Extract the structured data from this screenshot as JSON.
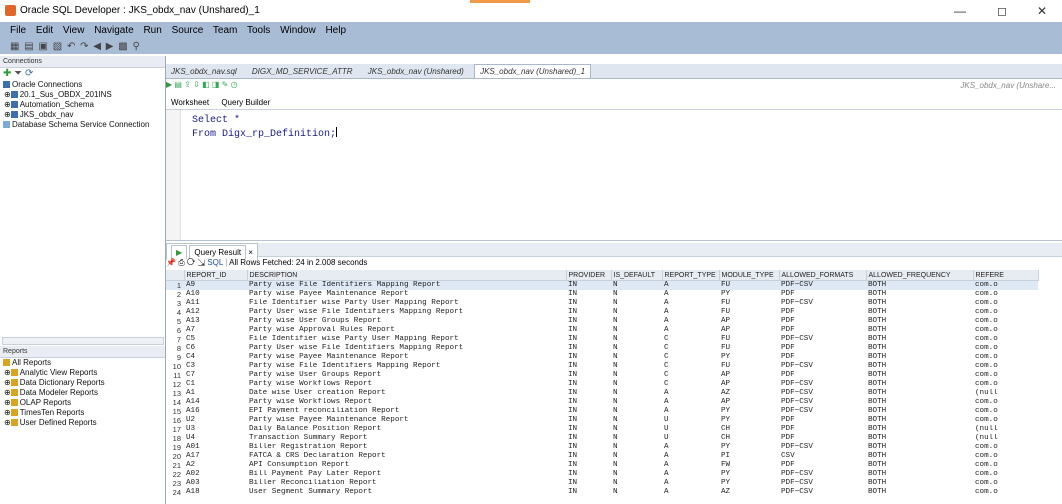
{
  "window": {
    "title": "Oracle SQL Developer : JKS_obdx_nav (Unshared)_1",
    "minimize": "—",
    "maximize": "◻",
    "close": "✕"
  },
  "menu": [
    "File",
    "Edit",
    "View",
    "Navigate",
    "Run",
    "Source",
    "Team",
    "Tools",
    "Window",
    "Help"
  ],
  "connections": {
    "header": "Connections",
    "items": [
      "Oracle Connections",
      "20.1_Sus_OBDX_201INS",
      "Automation_Schema",
      "JKS_obdx_nav",
      "Database Schema Service Connection"
    ]
  },
  "reports": {
    "header": "Reports",
    "items": [
      "All Reports",
      "Analytic View Reports",
      "Data Dictionary Reports",
      "Data Modeler Reports",
      "OLAP Reports",
      "TimesTen Reports",
      "User Defined Reports"
    ]
  },
  "doc_tabs": [
    "JKS_obdx_nav.sql",
    "DIGX_MD_SERVICE_ATTR",
    "JKS_obdx_nav (Unshared)",
    "JKS_obdx_nav (Unshared)_1"
  ],
  "connection_selector": "JKS_obdx_nav (Unshare...",
  "worksheet_tabs": [
    "Worksheet",
    "Query Builder"
  ],
  "editor": {
    "line1": "Select *",
    "line2": "From Digx_rp_Definition;"
  },
  "result_tab": "Query Result",
  "result_status": "All Rows Fetched: 24 in 2.008 seconds",
  "sql_label": "SQL",
  "columns": [
    "REPORT_ID",
    "DESCRIPTION",
    "PROVIDER",
    "IS_DEFAULT",
    "REPORT_TYPE",
    "MODULE_TYPE",
    "ALLOWED_FORMATS",
    "ALLOWED_FREQUENCY",
    "REFERE"
  ],
  "rows": [
    [
      "1",
      "A9",
      "Party wise File Identifiers Mapping Report",
      "IN",
      "N",
      "A",
      "FU",
      "PDF~CSV",
      "BOTH",
      "com.o"
    ],
    [
      "2",
      "A10",
      "Party wise Payee Maintenance Report",
      "IN",
      "N",
      "A",
      "PY",
      "PDF",
      "BOTH",
      "com.o"
    ],
    [
      "3",
      "A11",
      "File Identifier wise Party User Mapping Report",
      "IN",
      "N",
      "A",
      "FU",
      "PDF~CSV",
      "BOTH",
      "com.o"
    ],
    [
      "4",
      "A12",
      "Party User wise File Identifiers Mapping Report",
      "IN",
      "N",
      "A",
      "FU",
      "PDF",
      "BOTH",
      "com.o"
    ],
    [
      "5",
      "A13",
      "Party wise User Groups Report",
      "IN",
      "N",
      "A",
      "AP",
      "PDF",
      "BOTH",
      "com.o"
    ],
    [
      "6",
      "A7",
      "Party wise Approval Rules Report",
      "IN",
      "N",
      "A",
      "AP",
      "PDF",
      "BOTH",
      "com.o"
    ],
    [
      "7",
      "C5",
      "File Identifier wise Party User Mapping Report",
      "IN",
      "N",
      "C",
      "FU",
      "PDF~CSV",
      "BOTH",
      "com.o"
    ],
    [
      "8",
      "C6",
      "Party User wise File Identifiers Mapping Report",
      "IN",
      "N",
      "C",
      "FU",
      "PDF",
      "BOTH",
      "com.o"
    ],
    [
      "9",
      "C4",
      "Party wise Payee Maintenance Report",
      "IN",
      "N",
      "C",
      "PY",
      "PDF",
      "BOTH",
      "com.o"
    ],
    [
      "10",
      "C3",
      "Party wise File Identifiers Mapping Report",
      "IN",
      "N",
      "C",
      "FU",
      "PDF~CSV",
      "BOTH",
      "com.o"
    ],
    [
      "11",
      "C7",
      "Party wise User Groups Report",
      "IN",
      "N",
      "C",
      "AP",
      "PDF",
      "BOTH",
      "com.o"
    ],
    [
      "12",
      "C1",
      "Party wise Workflows Report",
      "IN",
      "N",
      "C",
      "AP",
      "PDF~CSV",
      "BOTH",
      "com.o"
    ],
    [
      "13",
      "A1",
      "Date wise User creation Report",
      "IN",
      "N",
      "A",
      "AZ",
      "PDF~CSV",
      "BOTH",
      "(null"
    ],
    [
      "14",
      "A14",
      "Party wise Workflows Report",
      "IN",
      "N",
      "A",
      "AP",
      "PDF~CSV",
      "BOTH",
      "com.o"
    ],
    [
      "15",
      "A16",
      "EPI Payment reconciliation Report",
      "IN",
      "N",
      "A",
      "PY",
      "PDF~CSV",
      "BOTH",
      "com.o"
    ],
    [
      "16",
      "U2",
      "Party wise Payee Maintenance Report",
      "IN",
      "N",
      "U",
      "PY",
      "PDF",
      "BOTH",
      "com.o"
    ],
    [
      "17",
      "U3",
      "Daily Balance Position Report",
      "IN",
      "N",
      "U",
      "CH",
      "PDF",
      "BOTH",
      "(null"
    ],
    [
      "18",
      "U4",
      "Transaction Summary Report",
      "IN",
      "N",
      "U",
      "CH",
      "PDF",
      "BOTH",
      "(null"
    ],
    [
      "19",
      "A01",
      "Biller Registration Report",
      "IN",
      "N",
      "A",
      "PY",
      "PDF~CSV",
      "BOTH",
      "com.o"
    ],
    [
      "20",
      "A17",
      "FATCA & CRS Declaration Report",
      "IN",
      "N",
      "A",
      "PI",
      "CSV",
      "BOTH",
      "com.o"
    ],
    [
      "21",
      "A2",
      "API Consumption Report",
      "IN",
      "N",
      "A",
      "FW",
      "PDF",
      "BOTH",
      "com.o"
    ],
    [
      "22",
      "A02",
      "Bill Payment Pay Later Report",
      "IN",
      "N",
      "A",
      "PY",
      "PDF~CSV",
      "BOTH",
      "com.o"
    ],
    [
      "23",
      "A03",
      "Biller Reconciliation Report",
      "IN",
      "N",
      "A",
      "PY",
      "PDF~CSV",
      "BOTH",
      "com.o"
    ],
    [
      "24",
      "A18",
      "User Segment Summary Report",
      "IN",
      "N",
      "A",
      "AZ",
      "PDF~CSV",
      "BOTH",
      "com.o"
    ]
  ],
  "colors": {
    "menubar": "#a9bcd6",
    "tree_db": "#3a6fb0",
    "folder": "#d9a520",
    "run_green": "#2e9a3a",
    "pin_red": "#d24a2a"
  }
}
